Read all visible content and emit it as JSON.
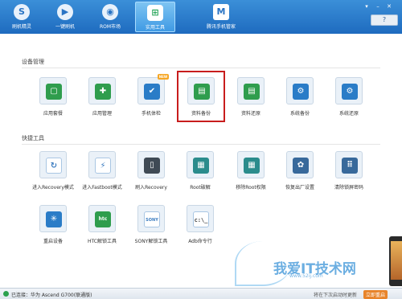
{
  "nav": {
    "items": [
      {
        "label": "刷机精灵",
        "icon": "s-logo-icon"
      },
      {
        "label": "一键刷机",
        "icon": "play-icon"
      },
      {
        "label": "ROM市场",
        "icon": "rom-market-icon"
      },
      {
        "label": "实用工具",
        "icon": "toolbox-icon",
        "active": true
      },
      {
        "label": "腾讯手机管家",
        "icon": "shield-icon"
      }
    ],
    "help_label": "?"
  },
  "device_management": {
    "title": "设备管理",
    "tools": [
      {
        "label": "应用套餐",
        "glyph": "▢"
      },
      {
        "label": "应用管理",
        "glyph": "✚"
      },
      {
        "label": "手机体检",
        "glyph": "✔",
        "badge": "NEW"
      },
      {
        "label": "资料备份",
        "glyph": "▤",
        "selected": true
      },
      {
        "label": "资料还原",
        "glyph": "▤"
      },
      {
        "label": "系统备份",
        "glyph": "⚙"
      },
      {
        "label": "系统还原",
        "glyph": "⚙"
      }
    ]
  },
  "quick_tools": {
    "title": "快捷工具",
    "row1": [
      {
        "label": "进入Recovery模式",
        "glyph": "↻"
      },
      {
        "label": "进入Fastboot模式",
        "glyph": "⚡"
      },
      {
        "label": "刷入Recovery",
        "glyph": "▯"
      },
      {
        "label": "Root破解",
        "glyph": "▦"
      },
      {
        "label": "移除Root权限",
        "glyph": "▦"
      },
      {
        "label": "恢复出厂设置",
        "glyph": "✿"
      },
      {
        "label": "清除锁屏密码",
        "glyph": "⠿"
      }
    ],
    "row2": [
      {
        "label": "重启设备",
        "glyph": "✳"
      },
      {
        "label": "HTC解锁工具",
        "glyph": "htc"
      },
      {
        "label": "SONY解锁工具",
        "glyph": "SONY"
      },
      {
        "label": "Adb命令行",
        "glyph": "c:\\_"
      }
    ]
  },
  "status": {
    "connected": "已连接：华为 Ascend G700(联通版)",
    "right_text": "将在下次启动时更新",
    "update_link": "立即重启"
  },
  "watermark": {
    "text": "我爱IT技术网",
    "sub": "www.52ij.com"
  },
  "colors": {
    "topbar": "#1e6bbf",
    "selected_outline": "#c81d1d"
  }
}
